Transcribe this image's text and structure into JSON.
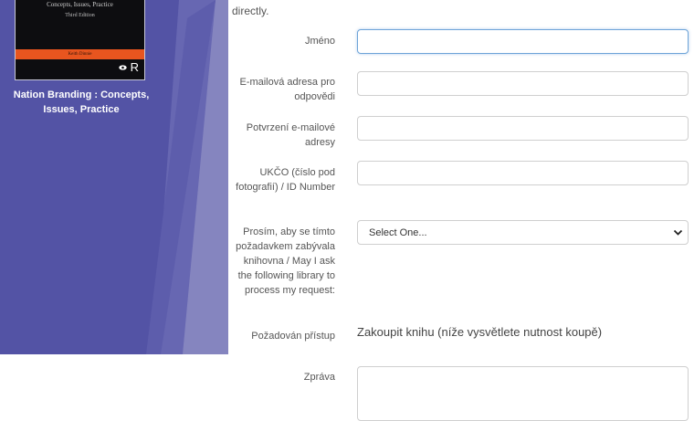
{
  "book": {
    "cover_subtitle": "Concepts, Issues, Practice",
    "cover_edition": "Third Edition",
    "cover_author": "Keith Dinnie",
    "cover_logo": "R",
    "title": "Nation Branding : Concepts, Issues, Practice"
  },
  "form": {
    "intro_text": "directly.",
    "name_label": "Jméno",
    "name_value": "",
    "email_label": "E-mailová adresa pro odpovědi",
    "email_value": "",
    "email_confirm_label": "Potvrzení e-mailové adresy",
    "email_confirm_value": "",
    "id_label": "UKČO (číslo pod fotografií) / ID Number",
    "id_value": "",
    "library_label": "Prosím, aby se tímto požadavkem zabývala knihovna / May I ask the following library to process my request:",
    "library_selected": "Select One...",
    "access_label": "Požadován přístup",
    "access_value": "Zakoupit knihu (níže vysvětlete nutnost koupě)",
    "message_label": "Zpráva",
    "message_value": ""
  },
  "colors": {
    "panel": "#5353a5",
    "cover_band": "#e8551f",
    "focus_border": "#6ea4d8"
  },
  "icons": {
    "select_chevron": "chevron-down-icon"
  }
}
